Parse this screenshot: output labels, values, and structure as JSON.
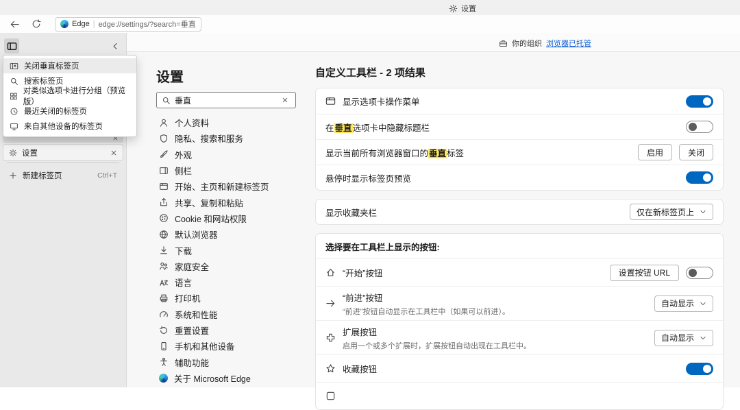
{
  "colors": {
    "accent": "#0067c0",
    "highlight": "#ffe95e",
    "link": "#0b5cd5"
  },
  "window": {
    "title": "设置"
  },
  "browser": {
    "site_label": "Edge",
    "divider": "|",
    "url": "edge://settings/?search=垂直",
    "managed_prefix": "你的组织",
    "managed_link": "浏览器已托管"
  },
  "vertical_tabs": {
    "menu": [
      {
        "label": "关闭垂直标签页"
      },
      {
        "label": "搜索标签页"
      },
      {
        "label": "对类似选项卡进行分组（预览版）"
      },
      {
        "label": "最近关闭的标签页"
      },
      {
        "label": "来自其他设备的标签页"
      }
    ],
    "active_tab": "设置",
    "new_tab": "新建标签页",
    "new_tab_shortcut": "Ctrl+T"
  },
  "settings_nav": {
    "title": "设置",
    "search_value": "垂直",
    "items": [
      "个人资料",
      "隐私、搜索和服务",
      "外观",
      "侧栏",
      "开始、主页和新建标签页",
      "共享、复制和粘贴",
      "Cookie 和网站权限",
      "默认浏览器",
      "下载",
      "家庭安全",
      "语言",
      "打印机",
      "系统和性能",
      "重置设置",
      "手机和其他设备",
      "辅助功能",
      "关于 Microsoft Edge"
    ]
  },
  "content": {
    "heading": "自定义工具栏 - 2 项结果",
    "rows": {
      "tab_actions": {
        "label": "显示选项卡操作菜单",
        "toggle": "on"
      },
      "hide_title": {
        "pre": "在",
        "hl": "垂直",
        "post": "选项卡中隐藏标题栏",
        "toggle": "off"
      },
      "all_windows": {
        "pre": "显示当前所有浏览器窗口的",
        "hl": "垂直",
        "post": "标签",
        "enable": "启用",
        "close": "关闭"
      },
      "hover_preview": {
        "label": "悬停时显示标签页预览",
        "toggle": "on"
      },
      "favorites_bar": {
        "label": "显示收藏夹栏",
        "dropdown": "仅在新标签页上"
      },
      "buttons_header": "选择要在工具栏上显示的按钮:",
      "home_btn": {
        "label": "“开始”按钮",
        "button": "设置按钮 URL",
        "toggle": "off"
      },
      "forward_btn": {
        "label": "“前进”按钮",
        "desc": "“前进”按钮自动显示在工具栏中（如果可以前进）。",
        "dropdown": "自动显示"
      },
      "ext_btn": {
        "label": "扩展按钮",
        "desc": "启用一个或多个扩展时，扩展按钮自动出现在工具栏中。",
        "dropdown": "自动显示"
      },
      "fav_btn": {
        "label": "收藏按钮",
        "toggle": "on"
      },
      "partial": {
        "label": ""
      }
    }
  }
}
